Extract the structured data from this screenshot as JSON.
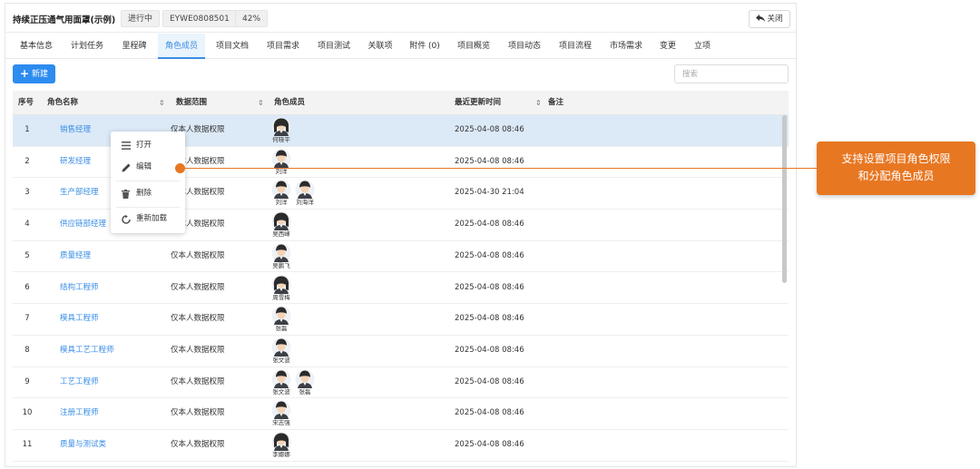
{
  "header": {
    "title": "持续正压通气用面罩(示例)",
    "status": "进行中",
    "code": "EYWE0808501",
    "progress": "42%",
    "close_label": "关闭"
  },
  "tabs": [
    {
      "label": "基本信息"
    },
    {
      "label": "计划任务"
    },
    {
      "label": "里程碑"
    },
    {
      "label": "角色成员"
    },
    {
      "label": "项目文档"
    },
    {
      "label": "项目需求"
    },
    {
      "label": "项目测试"
    },
    {
      "label": "关联项"
    },
    {
      "label": "附件 (0)"
    },
    {
      "label": "项目概览"
    },
    {
      "label": "项目动态"
    },
    {
      "label": "项目流程"
    },
    {
      "label": "市场需求"
    },
    {
      "label": "变更"
    },
    {
      "label": "立项"
    }
  ],
  "active_tab": "角色成员",
  "toolbar": {
    "new_label": "新建",
    "search_placeholder": "搜索"
  },
  "table": {
    "columns": {
      "index": "序号",
      "name": "角色名称",
      "scope": "数据范围",
      "members": "角色成员",
      "updated": "最近更新时间",
      "note": "备注"
    },
    "rows": [
      {
        "index": "1",
        "name": "销售经理",
        "scope": "仅本人数据权限",
        "members": [
          {
            "name": "何晓平",
            "gender": "female"
          }
        ],
        "updated": "2025-04-08 08:46",
        "selected": true
      },
      {
        "index": "2",
        "name": "研发经理",
        "scope": "仅本人数据权限",
        "members": [
          {
            "name": "刘洋",
            "gender": "male"
          }
        ],
        "updated": "2025-04-08 08:46"
      },
      {
        "index": "3",
        "name": "生产部经理",
        "scope": "仅本人数据权限",
        "members": [
          {
            "name": "刘洋",
            "gender": "male"
          },
          {
            "name": "刘海洋",
            "gender": "male"
          }
        ],
        "updated": "2025-04-30 21:04"
      },
      {
        "index": "4",
        "name": "供应链部经理",
        "scope": "仅本人数据权限",
        "members": [
          {
            "name": "吴西峰",
            "gender": "female"
          }
        ],
        "updated": "2025-04-08 08:46"
      },
      {
        "index": "5",
        "name": "质量经理",
        "scope": "仅本人数据权限",
        "members": [
          {
            "name": "吴鹏飞",
            "gender": "male"
          }
        ],
        "updated": "2025-04-08 08:46"
      },
      {
        "index": "6",
        "name": "结构工程师",
        "scope": "仅本人数据权限",
        "members": [
          {
            "name": "周雪梅",
            "gender": "female"
          }
        ],
        "updated": "2025-04-08 08:46"
      },
      {
        "index": "7",
        "name": "模具工程师",
        "scope": "仅本人数据权限",
        "members": [
          {
            "name": "张磊",
            "gender": "male"
          }
        ],
        "updated": "2025-04-08 08:46"
      },
      {
        "index": "8",
        "name": "模具工艺工程师",
        "scope": "仅本人数据权限",
        "members": [
          {
            "name": "张文波",
            "gender": "male"
          }
        ],
        "updated": "2025-04-08 08:46"
      },
      {
        "index": "9",
        "name": "工艺工程师",
        "scope": "仅本人数据权限",
        "members": [
          {
            "name": "张文波",
            "gender": "male"
          },
          {
            "name": "张磊",
            "gender": "male"
          }
        ],
        "updated": "2025-04-08 08:46"
      },
      {
        "index": "10",
        "name": "注册工程师",
        "scope": "仅本人数据权限",
        "members": [
          {
            "name": "宋志强",
            "gender": "male"
          }
        ],
        "updated": "2025-04-08 08:46"
      },
      {
        "index": "11",
        "name": "质量与测试类",
        "scope": "仅本人数据权限",
        "members": [
          {
            "name": "李娜娜",
            "gender": "female"
          }
        ],
        "updated": "2025-04-08 08:46"
      }
    ]
  },
  "context_menu": {
    "items": [
      {
        "label": "打开",
        "icon": "open-icon"
      },
      {
        "label": "编辑",
        "icon": "edit-icon"
      },
      {
        "label": "删除",
        "icon": "trash-icon"
      },
      {
        "label": "重新加载",
        "icon": "reload-icon"
      }
    ]
  },
  "callout": {
    "line1": "支持设置项目角色权限",
    "line2": "和分配角色成员"
  },
  "colors": {
    "accent": "#2d8cf0",
    "link": "#3a8ee6",
    "selected_row": "#dce9f7",
    "callout": "#e87722"
  }
}
